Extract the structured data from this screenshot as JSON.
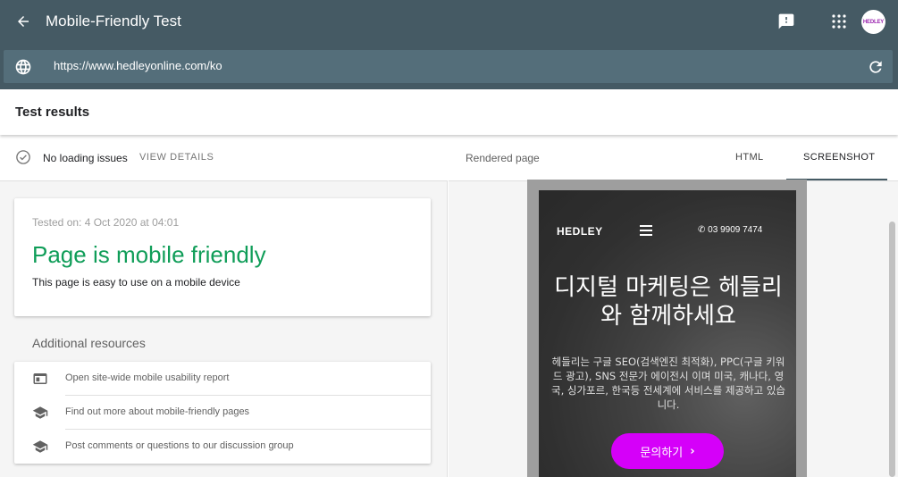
{
  "app": {
    "title": "Mobile-Friendly Test",
    "avatar_text": "HEDLEY"
  },
  "urlbar": {
    "value": "https://www.hedleyonline.com/ko"
  },
  "results": {
    "title": "Test results",
    "status_text": "No loading issues",
    "view_details": "VIEW DETAILS"
  },
  "card": {
    "tested_on": "Tested on: 4 Oct 2020 at 04:01",
    "verdict": "Page is mobile friendly",
    "verdict_sub": "This page is easy to use on a mobile device",
    "verdict_color": "#0f9d58"
  },
  "resources": {
    "title": "Additional resources",
    "items": [
      {
        "icon": "report-icon",
        "label": "Open site-wide mobile usability report"
      },
      {
        "icon": "school-icon",
        "label": "Find out more about mobile-friendly pages"
      },
      {
        "icon": "school-icon",
        "label": "Post comments or questions to our discussion group"
      }
    ]
  },
  "rendered": {
    "title": "Rendered page",
    "tabs": [
      {
        "label": "HTML",
        "selected": false
      },
      {
        "label": "SCREENSHOT",
        "selected": true
      }
    ]
  },
  "site": {
    "logo": "HEDLEY",
    "phone": "03 9909 7474",
    "headline": "디지털 마케팅은 헤들리와 함께하세요",
    "body": "헤들리는 구글 SEO(검색엔진 최적화), PPC(구글 키워드 광고), SNS 전문가 에이전시 이며 미국, 캐나다, 영국, 싱가포르, 한국등 전세계에 서비스를 제공하고 있습니다.",
    "cta": "문의하기",
    "cta_color": "#d500f9"
  },
  "colors": {
    "header": "#455a64",
    "urlbar": "#546e7a",
    "accent_green": "#0f9d58"
  }
}
